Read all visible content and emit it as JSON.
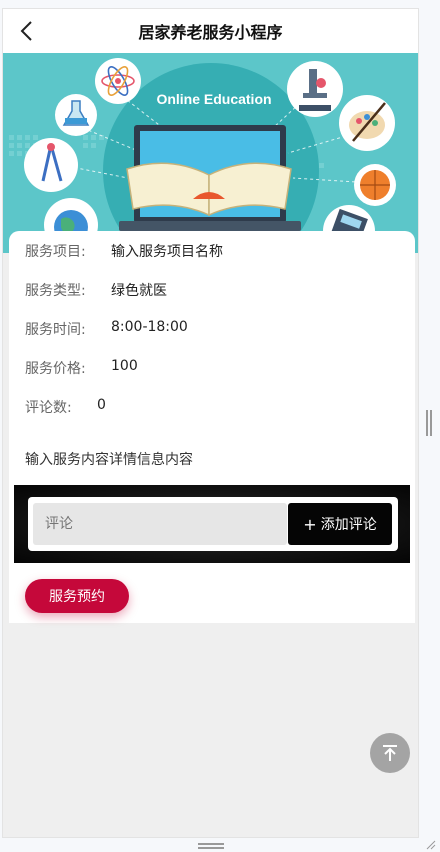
{
  "nav": {
    "title": "居家养老服务小程序"
  },
  "banner": {
    "caption": "Online Education"
  },
  "service": {
    "item_label": "服务项目:",
    "item_value": "输入服务项目名称",
    "type_label": "服务类型:",
    "type_value": "绿色就医",
    "time_label": "服务时间:",
    "time_value": "8:00-18:00",
    "price_label": "服务价格:",
    "price_value": "100",
    "comments_label": "评论数:",
    "comments_value": "0",
    "detail": "输入服务内容详情信息内容"
  },
  "comment": {
    "placeholder": "评论",
    "add_label": "添加评论"
  },
  "booking": {
    "button_label": "服务预约"
  },
  "colors": {
    "accent": "#c5083a",
    "banner_bg": "#5cc6c9",
    "dark_band": "#111111"
  }
}
